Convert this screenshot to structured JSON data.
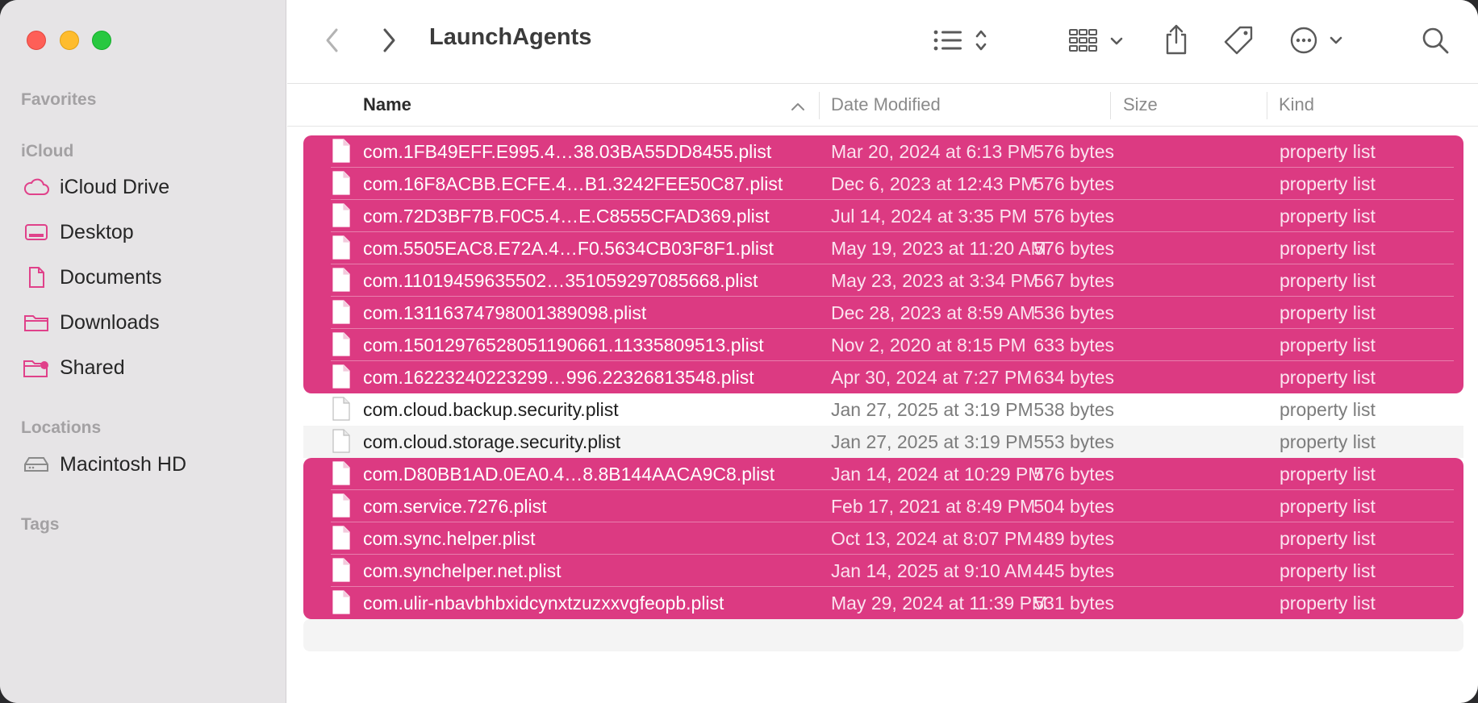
{
  "window": {
    "title": "LaunchAgents",
    "colors": {
      "selection": "#dc3a82",
      "sidebar_accent": "#e0418a"
    }
  },
  "sidebar": {
    "sections": {
      "favorites": "Favorites",
      "icloud": "iCloud",
      "locations": "Locations",
      "tags": "Tags"
    },
    "items": [
      {
        "label": "iCloud Drive",
        "icon": "cloud-icon"
      },
      {
        "label": "Desktop",
        "icon": "desktop-icon"
      },
      {
        "label": "Documents",
        "icon": "document-icon"
      },
      {
        "label": "Downloads",
        "icon": "folder-icon"
      },
      {
        "label": "Shared",
        "icon": "shared-folder-icon"
      },
      {
        "label": "Macintosh HD",
        "icon": "hard-drive-icon"
      }
    ]
  },
  "toolbar": {
    "icons": [
      "back-icon",
      "forward-icon",
      "list-view-icon",
      "group-icon",
      "share-icon",
      "tag-icon",
      "more-icon",
      "search-icon"
    ]
  },
  "columns": {
    "name": "Name",
    "date": "Date Modified",
    "size": "Size",
    "kind": "Kind"
  },
  "files": [
    {
      "name": "com.1FB49EFF.E995.4…38.03BA55DD8455.plist",
      "date": "Mar 20, 2024 at 6:13 PM",
      "size": "576 bytes",
      "kind": "property list",
      "selected": true
    },
    {
      "name": "com.16F8ACBB.ECFE.4…B1.3242FEE50C87.plist",
      "date": "Dec 6, 2023 at 12:43 PM",
      "size": "576 bytes",
      "kind": "property list",
      "selected": true
    },
    {
      "name": "com.72D3BF7B.F0C5.4…E.C8555CFAD369.plist",
      "date": "Jul 14, 2024 at 3:35 PM",
      "size": "576 bytes",
      "kind": "property list",
      "selected": true
    },
    {
      "name": "com.5505EAC8.E72A.4…F0.5634CB03F8F1.plist",
      "date": "May 19, 2023 at 11:20 AM",
      "size": "576 bytes",
      "kind": "property list",
      "selected": true
    },
    {
      "name": "com.11019459635502…351059297085668.plist",
      "date": "May 23, 2023 at 3:34 PM",
      "size": "567 bytes",
      "kind": "property list",
      "selected": true
    },
    {
      "name": "com.13116374798001389098.plist",
      "date": "Dec 28, 2023 at 8:59 AM",
      "size": "536 bytes",
      "kind": "property list",
      "selected": true
    },
    {
      "name": "com.15012976528051190661.11335809513.plist",
      "date": "Nov 2, 2020 at 8:15 PM",
      "size": "633 bytes",
      "kind": "property list",
      "selected": true
    },
    {
      "name": "com.16223240223299…996.22326813548.plist",
      "date": "Apr 30, 2024 at 7:27 PM",
      "size": "634 bytes",
      "kind": "property list",
      "selected": true
    },
    {
      "name": "com.cloud.backup.security.plist",
      "date": "Jan 27, 2025 at 3:19 PM",
      "size": "538 bytes",
      "kind": "property list",
      "selected": false
    },
    {
      "name": "com.cloud.storage.security.plist",
      "date": "Jan 27, 2025 at 3:19 PM",
      "size": "553 bytes",
      "kind": "property list",
      "selected": false
    },
    {
      "name": "com.D80BB1AD.0EA0.4…8.8B144AACA9C8.plist",
      "date": "Jan 14, 2024 at 10:29 PM",
      "size": "576 bytes",
      "kind": "property list",
      "selected": true
    },
    {
      "name": "com.service.7276.plist",
      "date": "Feb 17, 2021 at 8:49 PM",
      "size": "504 bytes",
      "kind": "property list",
      "selected": true
    },
    {
      "name": "com.sync.helper.plist",
      "date": "Oct 13, 2024 at 8:07 PM",
      "size": "489 bytes",
      "kind": "property list",
      "selected": true
    },
    {
      "name": "com.synchelper.net.plist",
      "date": "Jan 14, 2025 at 9:10 AM",
      "size": "445 bytes",
      "kind": "property list",
      "selected": true
    },
    {
      "name": "com.ulir-nbavbhbxidcynxtzuzxxvgfeopb.plist",
      "date": "May 29, 2024 at 11:39 PM",
      "size": "531 bytes",
      "kind": "property list",
      "selected": true
    }
  ]
}
